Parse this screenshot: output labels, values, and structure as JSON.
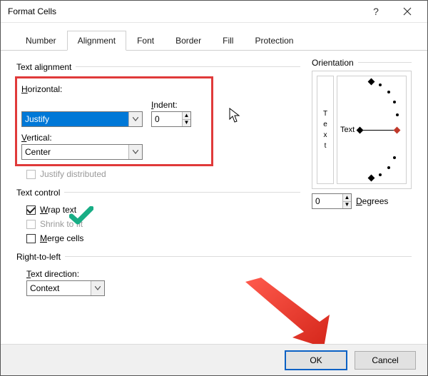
{
  "window": {
    "title": "Format Cells"
  },
  "tabs": {
    "number": "Number",
    "alignment": "Alignment",
    "font": "Font",
    "border": "Border",
    "fill": "Fill",
    "protection": "Protection"
  },
  "groups": {
    "text_alignment": "Text alignment",
    "text_control": "Text control",
    "rtl": "Right-to-left",
    "orientation": "Orientation"
  },
  "fields": {
    "horizontal_h": "H",
    "horizontal_rest": "orizontal:",
    "horizontal_value": "Justify",
    "indent_i": "I",
    "indent_rest": "ndent:",
    "indent_value": "0",
    "vertical_v": "V",
    "vertical_rest": "ertical:",
    "vertical_value": "Center",
    "justify_distributed": "Justify distributed",
    "wrap_w": "W",
    "wrap_rest": "rap text",
    "shrink": "Shrink to fit",
    "merge_m": "M",
    "merge_rest": "erge cells",
    "text_direction_t": "T",
    "text_direction_rest": "ext direction:",
    "text_direction_value": "Context",
    "degrees_d": "D",
    "degrees_rest": "egrees",
    "degrees_value": "0",
    "orientation_text": "Text",
    "vtext_t": "T",
    "vtext_e": "e",
    "vtext_x": "x",
    "vtext_t2": "t"
  },
  "buttons": {
    "ok": "OK",
    "cancel": "Cancel"
  }
}
